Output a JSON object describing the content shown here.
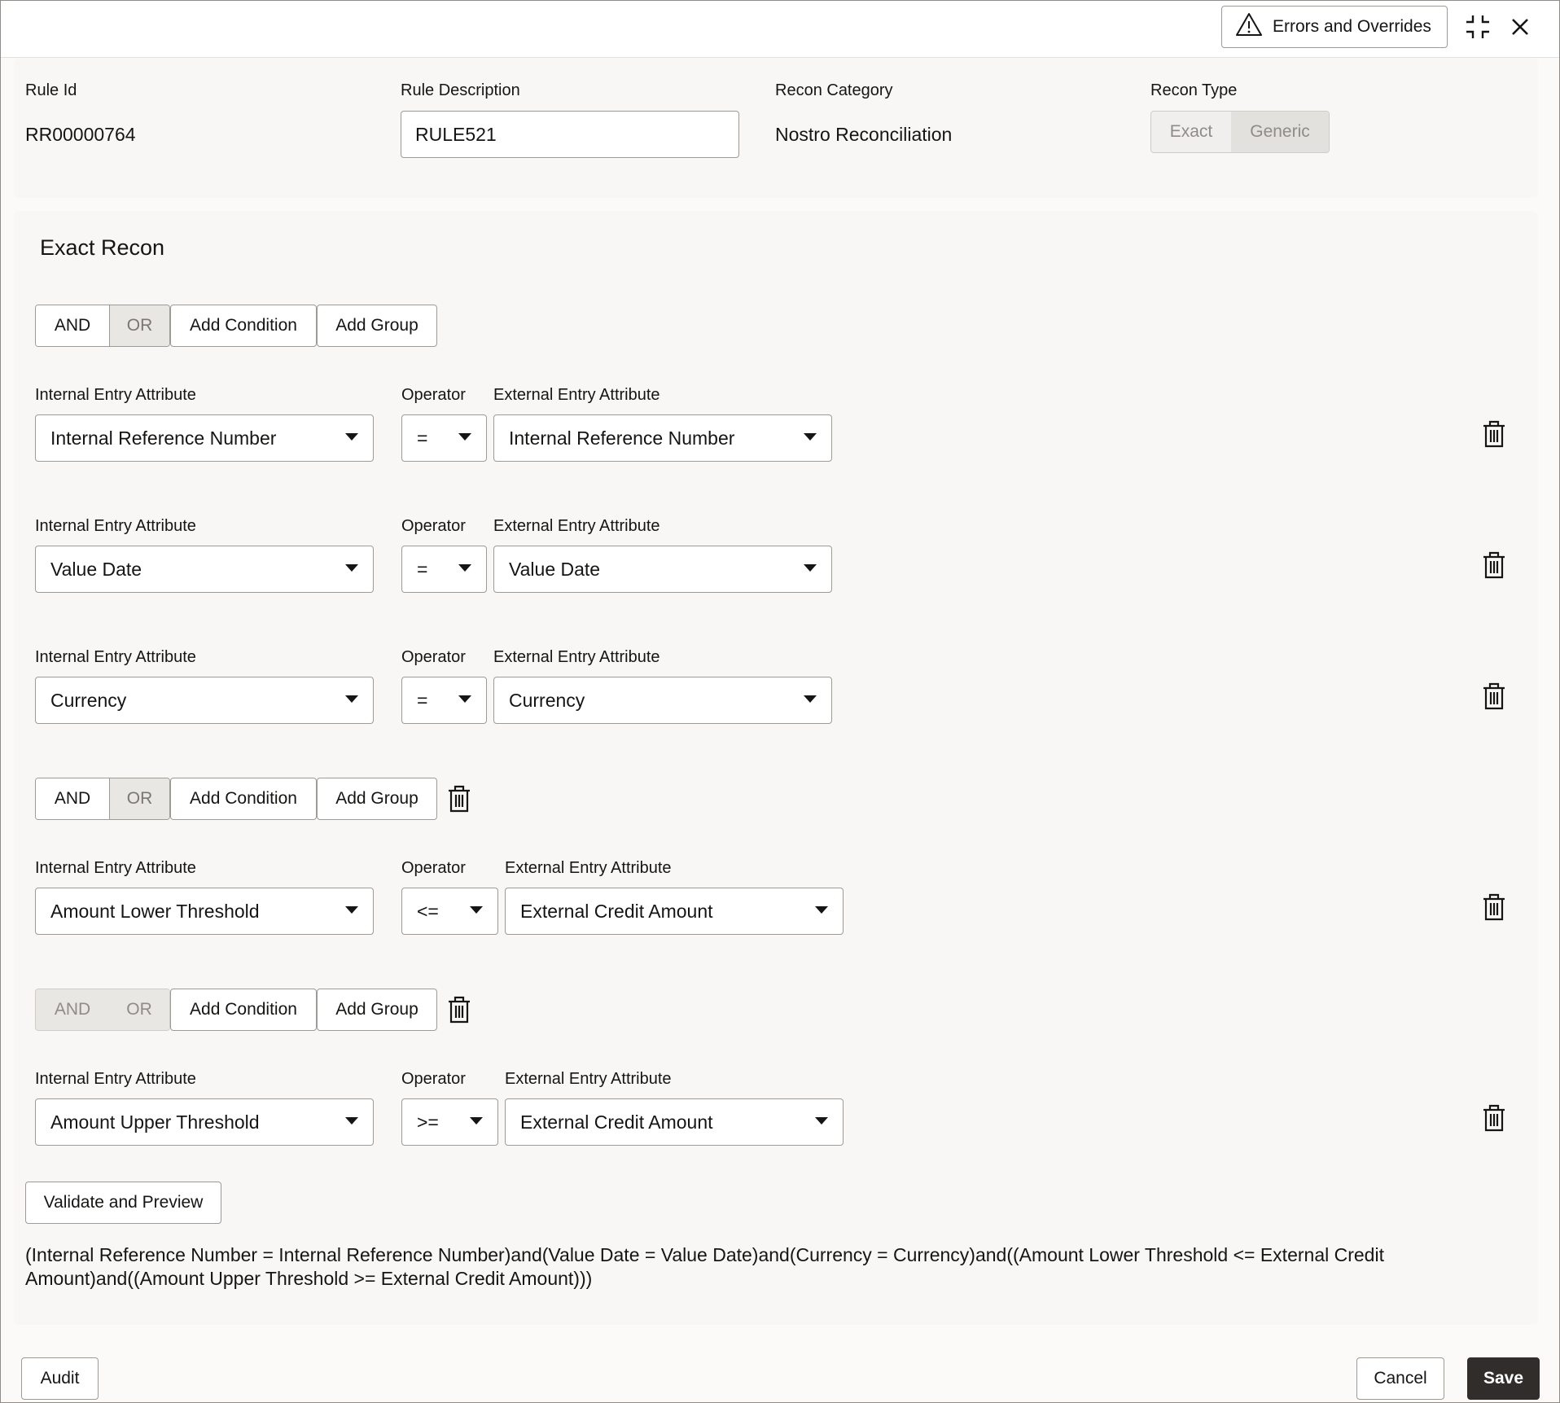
{
  "topbar": {
    "errors_label": "Errors and Overrides",
    "icons": [
      "warning-icon",
      "minimize-icon",
      "close-icon"
    ]
  },
  "header": {
    "rule_id_label": "Rule Id",
    "rule_id_value": "RR00000764",
    "rule_desc_label": "Rule Description",
    "rule_desc_value": "RULE521",
    "recon_category_label": "Recon Category",
    "recon_category_value": "Nostro Reconciliation",
    "recon_type_label": "Recon Type",
    "recon_type_options": [
      "Exact",
      "Generic"
    ]
  },
  "section": {
    "title": "Exact Recon"
  },
  "group_controls": {
    "and_label": "AND",
    "or_label": "OR",
    "add_condition_label": "Add Condition",
    "add_group_label": "Add Group"
  },
  "labels": {
    "internal": "Internal Entry Attribute",
    "operator": "Operator",
    "external": "External Entry Attribute"
  },
  "conditions": [
    {
      "internal": "Internal Reference Number",
      "operator": "=",
      "external": "Internal Reference Number"
    },
    {
      "internal": "Value Date",
      "operator": "=",
      "external": "Value Date"
    },
    {
      "internal": "Currency",
      "operator": "=",
      "external": "Currency"
    },
    {
      "internal": "Amount Lower Threshold",
      "operator": "<=",
      "external": "External Credit Amount"
    },
    {
      "internal": "Amount Upper Threshold",
      "operator": ">=",
      "external": "External Credit Amount"
    }
  ],
  "validate_label": "Validate and Preview",
  "preview_text": "(Internal Reference Number = Internal Reference Number)and(Value Date = Value Date)and(Currency = Currency)and((Amount Lower Threshold <= External Credit Amount)and((Amount Upper Threshold >= External Credit Amount)))",
  "footer": {
    "audit_label": "Audit",
    "cancel_label": "Cancel",
    "save_label": "Save"
  }
}
